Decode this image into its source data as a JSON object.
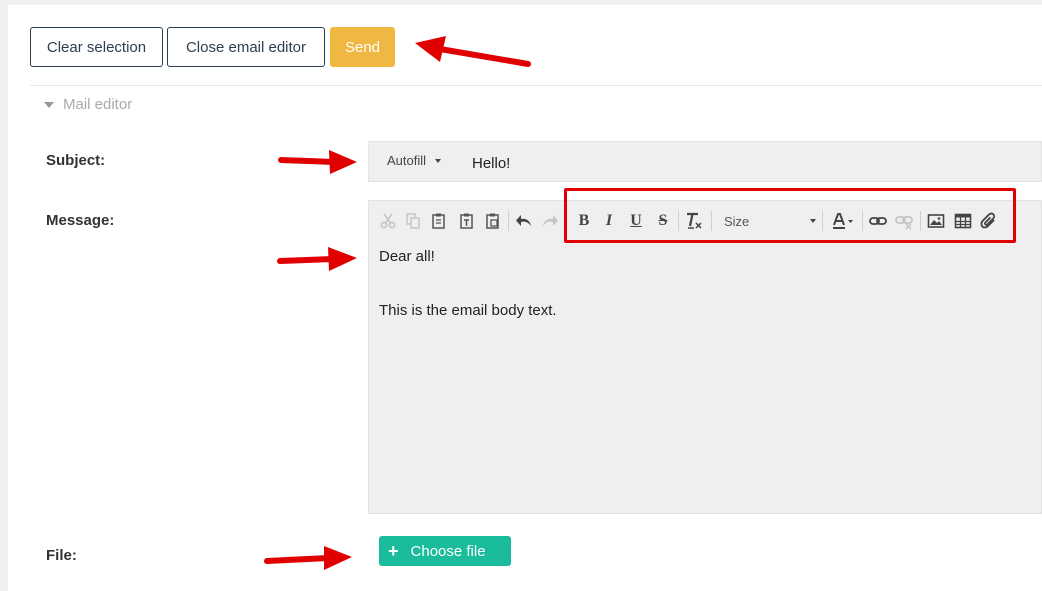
{
  "toolbar": {
    "clear_selection": "Clear selection",
    "close_editor": "Close email editor",
    "send": "Send"
  },
  "mail_editor": {
    "section_title": "Mail editor",
    "subject_label": "Subject:",
    "message_label": "Message:",
    "file_label": "File:",
    "autofill_label": "Autofill",
    "subject_value": "Hello!",
    "size_select": "Size",
    "body_lines": [
      "Dear all!",
      "This is the email body text."
    ],
    "choose_file": "Choose file",
    "choose_file_icon": "plus-icon"
  },
  "editor_toolbar_icons": [
    "cut-icon",
    "copy-icon",
    "paste-icon",
    "paste-text-icon",
    "paste-word-icon",
    "undo-icon",
    "redo-icon",
    "bold-icon",
    "italic-icon",
    "underline-icon",
    "strikethrough-icon",
    "remove-format-icon",
    "text-color-icon",
    "link-icon",
    "unlink-icon",
    "image-icon",
    "table-icon",
    "attachment-icon"
  ],
  "colors": {
    "send_button": "#f0b840",
    "file_button": "#1abc9c",
    "annotation_red": "#e00000",
    "editor_background": "#efefef"
  }
}
